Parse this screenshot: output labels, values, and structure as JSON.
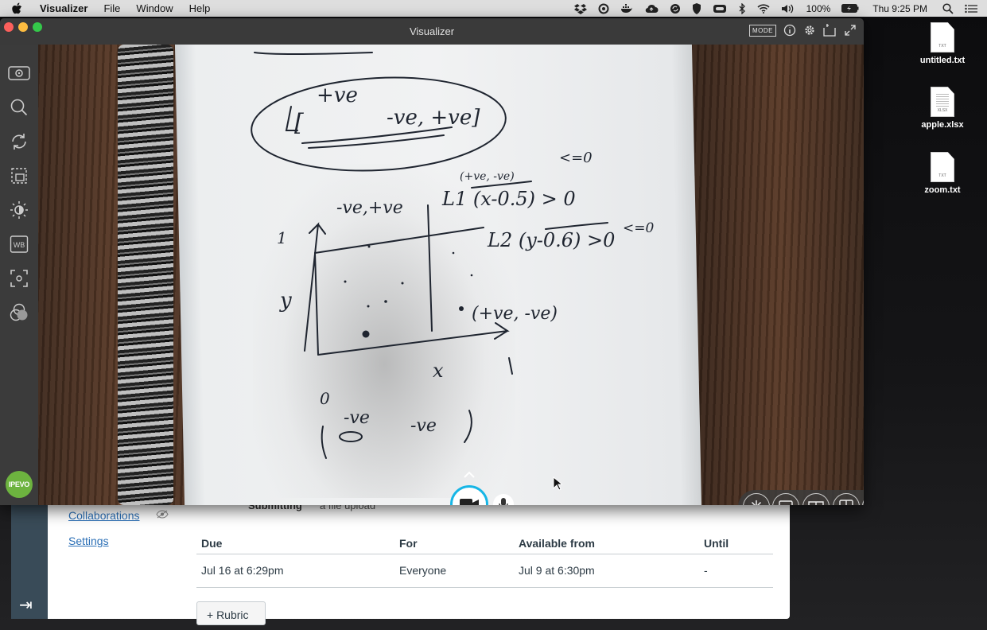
{
  "menubar": {
    "app_name": "Visualizer",
    "menus": [
      "File",
      "Window",
      "Help"
    ],
    "battery": "100%",
    "clock": "Thu 9:25 PM"
  },
  "desktop_icons": [
    {
      "name": "untitled.txt",
      "badge": "TXT"
    },
    {
      "name": "apple.xlsx",
      "badge": "XLSX"
    },
    {
      "name": "zoom.txt",
      "badge": "TXT"
    }
  ],
  "window": {
    "title": "Visualizer",
    "mode_label": "MODE",
    "brand": "IPEVO",
    "sidebar_tools": [
      "camera-view-icon",
      "zoom-icon",
      "rotate-icon",
      "crop-icon",
      "brightness-icon",
      "whiteboard-icon",
      "focus-icon",
      "color-filter-icon"
    ],
    "right_tools": [
      "freeze-icon",
      "picture-in-picture-icon",
      "book-mode-icon",
      "split-view-icon",
      "fit-screen-icon"
    ]
  },
  "page": {
    "nav": {
      "collaborations": "Collaborations",
      "settings": "Settings"
    },
    "submitting_label": "Submitting",
    "submitting_value": "a file upload",
    "table": {
      "headers": [
        "Due",
        "For",
        "Available from",
        "Until"
      ],
      "rows": [
        [
          "Jul 16 at 6:29pm",
          "Everyone",
          "Jul 9 at 6:30pm",
          "-"
        ]
      ]
    },
    "rubric_button": "+ Rubric"
  },
  "colors": {
    "accent_camera": "#17b6e6",
    "ipevo_green": "#6db33f",
    "canvas_sidebar": "#394b58",
    "link": "#2b6fb6"
  }
}
